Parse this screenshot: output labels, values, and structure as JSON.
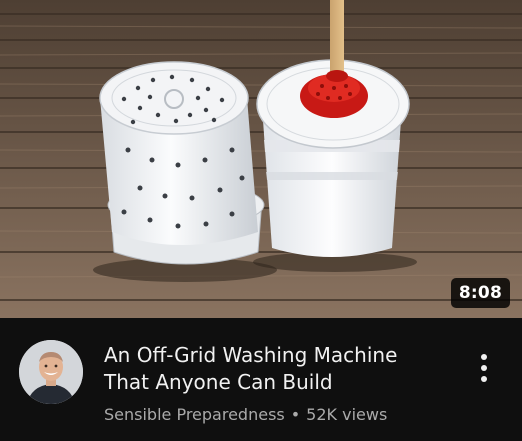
{
  "video": {
    "thumbnail_icon": "washing-machine-buckets-thumbnail",
    "duration": "8:08",
    "title": "An Off-Grid Washing Machine\nThat Anyone Can Build",
    "channel": "Sensible Preparedness",
    "separator": "•",
    "views": "52K views"
  },
  "more_menu_icon": "more-vertical-icon",
  "colors": {
    "background": "#0f0f0f",
    "title": "#f1f1f1",
    "secondary_text": "#aaaaaa",
    "plunger_red": "#d6201c"
  }
}
